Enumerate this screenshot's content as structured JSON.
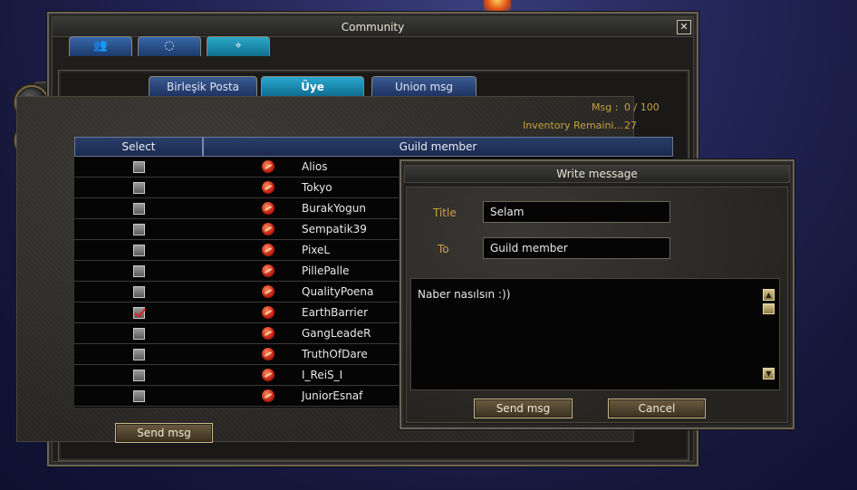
{
  "community": {
    "title": "Community",
    "close_label": "✕",
    "top_tabs": [
      {
        "label": "👥",
        "icon": "friends-icon"
      },
      {
        "label": "◌",
        "icon": "party-icon"
      },
      {
        "label": "⌖",
        "icon": "guild-icon"
      }
    ],
    "sub_tabs": [
      {
        "label": "Birleşik Posta Kutusu"
      },
      {
        "label": "Üye"
      },
      {
        "label": "Union msg"
      }
    ],
    "stats": {
      "msg_label": "Msg :",
      "msg_value": "0 / 100",
      "inventory_label": "Inventory Remaini...",
      "inventory_value": "27"
    },
    "table": {
      "col_select": "Select",
      "col_member": "Guild member",
      "rows": [
        {
          "name": "Alios",
          "checked": false
        },
        {
          "name": "Tokyo",
          "checked": false
        },
        {
          "name": "BurakYogun",
          "checked": false
        },
        {
          "name": "Sempatik39",
          "checked": false
        },
        {
          "name": "PixeL",
          "checked": false
        },
        {
          "name": "PillePalle",
          "checked": false
        },
        {
          "name": "QualityPoena",
          "checked": false
        },
        {
          "name": "EarthBarrier",
          "checked": true
        },
        {
          "name": "GangLeadeR",
          "checked": false
        },
        {
          "name": "TruthOfDare",
          "checked": false
        },
        {
          "name": "I_ReiS_I",
          "checked": false
        },
        {
          "name": "JuniorEsnaf",
          "checked": false
        }
      ]
    },
    "send_label": "Send msg"
  },
  "side_buttons": [
    {
      "icon": "compass-icon",
      "glyph": "◭"
    },
    {
      "icon": "refresh-icon",
      "glyph": "↻"
    }
  ],
  "dialog": {
    "title": "Write message",
    "title_label": "Title",
    "title_value": "Selam",
    "to_label": "To",
    "to_value": "Guild member",
    "message": "Naber nasılsın :))",
    "send_label": "Send msg",
    "cancel_label": "Cancel",
    "scroll_up": "▲",
    "scroll_down": "▼"
  }
}
